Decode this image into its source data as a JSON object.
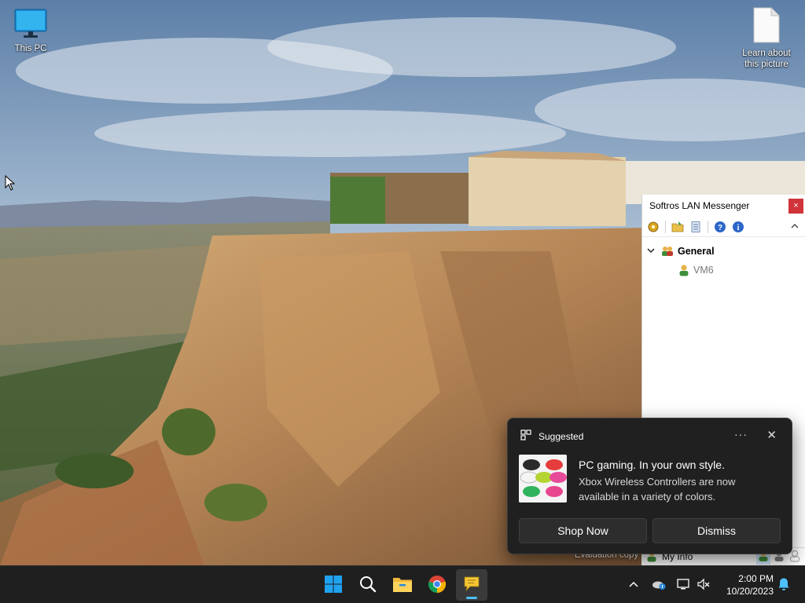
{
  "desktop": {
    "icons": [
      {
        "label": "This PC",
        "icon": "monitor-icon"
      },
      {
        "label": "Learn about this picture",
        "icon": "document-icon"
      }
    ]
  },
  "messenger": {
    "title": "Softros LAN Messenger",
    "close_label": "×",
    "collapse_label": "^",
    "toolbar": [
      "settings-gear-icon",
      "open-folder-icon",
      "message-log-icon",
      "help-icon",
      "info-icon"
    ],
    "group": {
      "name": "General",
      "expand": "▾"
    },
    "users": [
      {
        "name": "VM6"
      }
    ],
    "status": {
      "my_info": "My Info"
    },
    "evaluation_text": "Evaluation copy"
  },
  "notification": {
    "app_name": "Suggested",
    "more_label": "···",
    "close_label": "✕",
    "title": "PC gaming. In your own style.",
    "body": "Xbox Wireless Controllers are now available in a variety of colors.",
    "buttons": {
      "shop": "Shop Now",
      "dismiss": "Dismiss"
    }
  },
  "taskbar": {
    "apps": [
      "start-icon",
      "search-icon",
      "file-explorer-icon",
      "chrome-icon",
      "messenger-app-icon"
    ],
    "tray": [
      "chevron-up-icon",
      "onedrive-icon",
      "network-icon",
      "volume-mute-icon",
      "notification-bell-icon"
    ],
    "time": "2:00 PM",
    "date": "10/20/2023"
  },
  "colors": {
    "taskbar_bg": "#1f1f1f",
    "toast_bg": "#202020",
    "accent": "#4cc2ff",
    "close_red": "#d0333a"
  }
}
